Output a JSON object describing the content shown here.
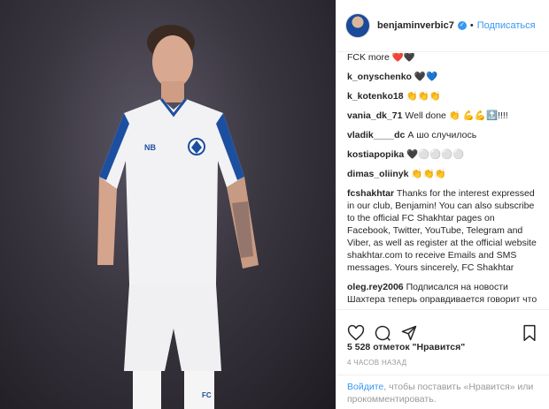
{
  "post": {
    "username": "benjaminverbic7",
    "separator": "•",
    "follow_label": "Подписаться",
    "likes_text": "5 528 отметок \"Нравится\"",
    "time_text": "4 ЧАСОВ НАЗАД"
  },
  "comments": [
    {
      "user": "",
      "text": "FCK more ❤️🖤"
    },
    {
      "user": "k_onyschenko",
      "text": "🖤💙"
    },
    {
      "user": "k_kotenko18",
      "text": "👏👏👏"
    },
    {
      "user": "vania_dk_71",
      "text": "Well done 👏 💪💪🔝!!!!"
    },
    {
      "user": "vladik____dc",
      "text": "А шо случилось"
    },
    {
      "user": "kostiapopika",
      "text": "🖤⚪⚪⚪⚪"
    },
    {
      "user": "dimas_oliinyk",
      "text": "👏👏👏"
    },
    {
      "user": "fcshakhtar",
      "text": "Thanks for the interest expressed in our club, Benjamin! You can also subscribe to the official FC Shakhtar pages on Facebook, Twitter, YouTube, Telegram and Viber, as well as register at the official website shakhtar.com to receive Emails and SMS messages. Yours sincerely, FC Shakhtar"
    },
    {
      "user": "oleg.rey2006",
      "text": "Подписался на новости Шахтера теперь оправдивается говорит что ошибочка вишла"
    }
  ],
  "login_bar": {
    "link": "Войдите",
    "text": ", чтобы поставить «Нравится» или прокомментировать."
  },
  "icons": {
    "like": "heart-icon",
    "comment": "comment-icon",
    "share": "share-icon",
    "save": "bookmark-icon",
    "verified": "verified-badge-icon"
  },
  "colors": {
    "link_blue": "#3897f0",
    "muted": "#999999",
    "text": "#262626"
  }
}
